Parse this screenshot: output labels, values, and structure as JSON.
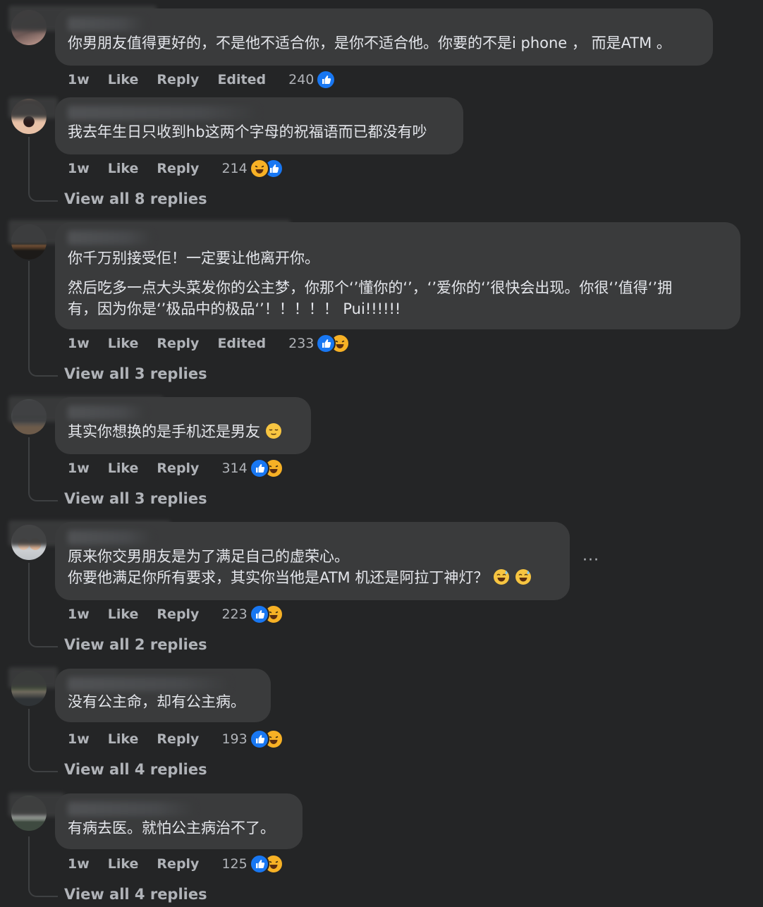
{
  "labels": {
    "time": "1w",
    "like": "Like",
    "reply": "Reply",
    "edited": "Edited"
  },
  "comments": [
    {
      "lines": [
        "你男朋友值得更好的，不是他不适合你，是你不适合他。你要的不是i phone ， 而是ATM 。"
      ],
      "time": "1w",
      "edited": true,
      "count": "240",
      "reactions": [
        "like"
      ],
      "view_replies": ""
    },
    {
      "lines": [
        "我去年生日只收到hb这两个字母的祝福语而已都没有吵"
      ],
      "time": "1w",
      "edited": false,
      "count": "214",
      "reactions": [
        "haha",
        "like"
      ],
      "view_replies": "View all 8 replies"
    },
    {
      "lines": [
        "你千万别接受佢！一定要让他离开你。",
        "然后吃多一点大头菜发你的公主梦，你那个‘’懂你的‘’，‘’爱你的‘’很快会出现。你很‘’值得‘’拥",
        "有，因为你是‘’极品中的极品‘’！！！！！ Pui!!!!!!"
      ],
      "time": "1w",
      "edited": true,
      "count": "233",
      "reactions": [
        "like",
        "haha"
      ],
      "view_replies": "View all 3 replies"
    },
    {
      "lines": [
        "其实你想换的是手机还是男友"
      ],
      "time": "1w",
      "edited": false,
      "count": "314",
      "reactions": [
        "like",
        "haha"
      ],
      "view_replies": "View all 3 replies"
    },
    {
      "lines": [
        "原来你交男朋友是为了满足自己的虚荣心。",
        "你要他满足你所有要求，其实你当他是ATM 机还是阿拉丁神灯？"
      ],
      "time": "1w",
      "edited": false,
      "count": "223",
      "reactions": [
        "like",
        "haha"
      ],
      "view_replies": "View all 2 replies",
      "more": "···"
    },
    {
      "lines": [
        "没有公主命，却有公主病。"
      ],
      "time": "1w",
      "edited": false,
      "count": "193",
      "reactions": [
        "like",
        "haha"
      ],
      "view_replies": "View all 4 replies"
    },
    {
      "lines": [
        "有病去医。就怕公主病治不了。"
      ],
      "time": "1w",
      "edited": false,
      "count": "125",
      "reactions": [
        "like",
        "haha"
      ],
      "view_replies": "View all 4 replies"
    }
  ],
  "colors": {
    "background": "#242526",
    "bubble": "#3a3b3c",
    "like_blue": "#1877f2",
    "haha_yellow": "#f7b125",
    "meta_gray": "#b0b3b8"
  }
}
